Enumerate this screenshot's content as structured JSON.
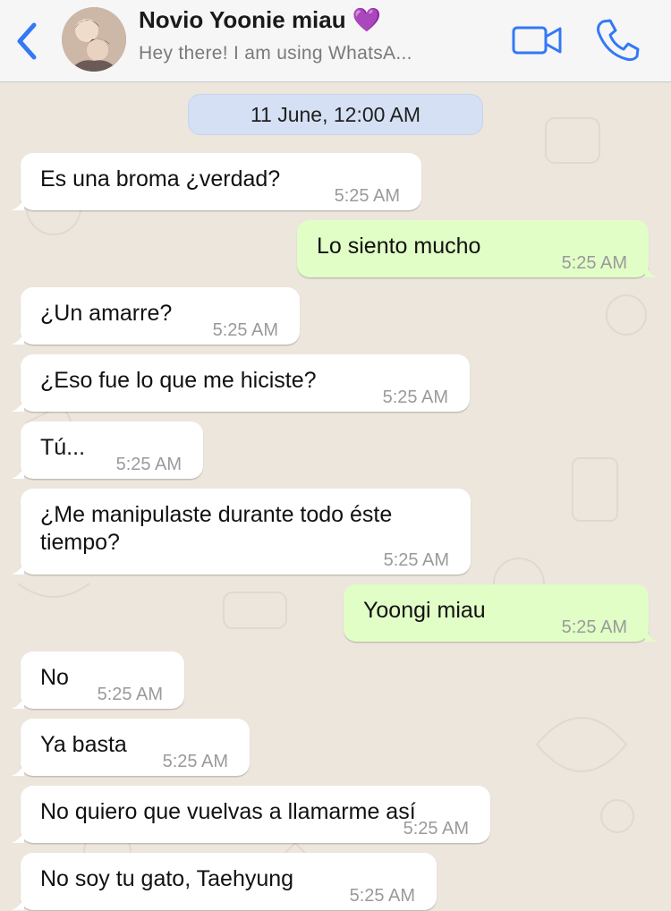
{
  "header": {
    "contact_name": "Novio Yoonie miau 💜",
    "contact_status": "Hey there! I am using WhatsA...",
    "back_icon": "chevron-left-icon",
    "video_icon": "video-camera-icon",
    "call_icon": "phone-icon",
    "accent_color": "#3478f6"
  },
  "chat": {
    "date_label": "11 June, 12:00 AM",
    "messages": [
      {
        "direction": "in",
        "text": "Es una broma ¿verdad?",
        "time": "5:25 AM"
      },
      {
        "direction": "out",
        "text": "Lo siento mucho",
        "time": "5:25 AM"
      },
      {
        "direction": "in",
        "text": "¿Un amarre?",
        "time": "5:25 AM"
      },
      {
        "direction": "in",
        "text": "¿Eso fue lo que me hiciste?",
        "time": "5:25 AM"
      },
      {
        "direction": "in",
        "text": "Tú...",
        "time": "5:25 AM"
      },
      {
        "direction": "in",
        "text": "¿Me manipulaste durante todo éste\ntiempo?",
        "time": "5:25 AM"
      },
      {
        "direction": "out",
        "text": "Yoongi miau",
        "time": "5:25 AM"
      },
      {
        "direction": "in",
        "text": "No",
        "time": "5:25 AM"
      },
      {
        "direction": "in",
        "text": "Ya basta",
        "time": "5:25 AM"
      },
      {
        "direction": "in",
        "text": "No quiero que vuelvas a llamarme así",
        "time": "5:25 AM"
      },
      {
        "direction": "in",
        "text": "No soy tu gato, Taehyung",
        "time": "5:25 AM"
      }
    ]
  }
}
